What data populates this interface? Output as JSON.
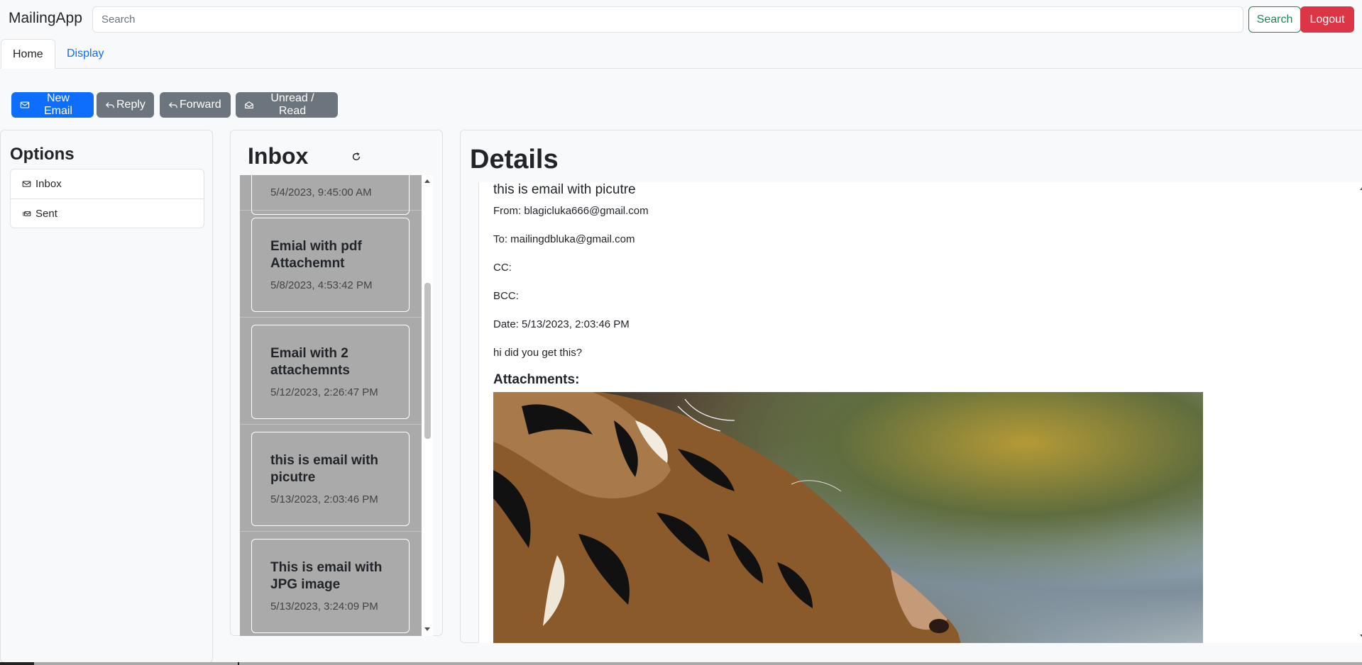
{
  "app": {
    "brand": "MailingApp"
  },
  "search": {
    "placeholder": "Search",
    "value": "",
    "button_label": "Search"
  },
  "auth": {
    "logout_label": "Logout"
  },
  "tabs": [
    {
      "label": "Home",
      "active": true
    },
    {
      "label": "Display",
      "active": false
    }
  ],
  "toolbar": {
    "new_email": "New Email",
    "reply": "Reply",
    "forward": "Forward",
    "unread_read": "Unread / Read"
  },
  "options": {
    "title": "Options",
    "items": [
      {
        "label": "Inbox",
        "icon": "envelope-icon"
      },
      {
        "label": "Sent",
        "icon": "envelope-sent-icon"
      }
    ]
  },
  "inbox": {
    "title": "Inbox",
    "emails": [
      {
        "subject": "",
        "date": "5/4/2023, 9:45:00 AM"
      },
      {
        "subject": "Emial with pdf Attachemnt",
        "date": "5/8/2023, 4:53:42 PM"
      },
      {
        "subject": "Email with 2 attachemnts",
        "date": "5/12/2023, 2:26:47 PM"
      },
      {
        "subject": "this is email with picutre",
        "date": "5/13/2023, 2:03:46 PM"
      },
      {
        "subject": "This is email with JPG image",
        "date": "5/13/2023, 3:24:09 PM"
      }
    ]
  },
  "details": {
    "title": "Details",
    "subject": "this is email with picutre",
    "from": "From: blagicluka666@gmail.com",
    "to": "To: mailingdbluka@gmail.com",
    "cc": "CC:",
    "bcc": "BCC:",
    "date": "Date: 5/13/2023, 2:03:46 PM",
    "body": "hi did you get this?",
    "attachments_heading": "Attachments:"
  },
  "colors": {
    "primary": "#0d6efd",
    "secondary": "#6c757d",
    "success": "#198754",
    "danger": "#dc3545",
    "inbox_bg": "#aaaaaa"
  }
}
